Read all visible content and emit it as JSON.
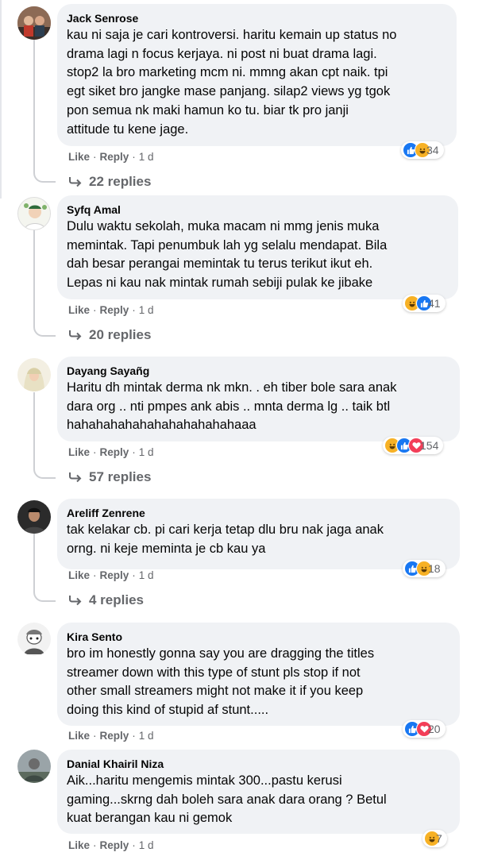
{
  "comments": [
    {
      "author": "Jack Senrose",
      "text": "kau ni saja je cari kontroversi. haritu kemain up status no\ndrama lagi n focus kerjaya. ni post ni buat drama lagi.\nstop2 la bro marketing mcm ni. mmng akan cpt naik. tpi\negt siket bro jangke mase panjang. silap2 views yg tgok\npon semua nk maki hamun ko tu. biar tk pro janji\nattitude tu kene jage.",
      "like": "Like",
      "reply": "Reply",
      "time": "1 d",
      "reactions": [
        "like",
        "haha"
      ],
      "count": "34",
      "replies": "22 replies"
    },
    {
      "author": "Syfq Amal",
      "text": "Dulu waktu sekolah, muka macam ni mmg jenis muka\nmemintak. Tapi penumbuk lah yg selalu mendapat. Bila\ndah besar perangai memintak tu terus terikut ikut eh.\nLepas ni kau nak mintak rumah sebiji pulak ke jibake",
      "like": "Like",
      "reply": "Reply",
      "time": "1 d",
      "reactions": [
        "haha",
        "like"
      ],
      "count": "41",
      "replies": "20 replies"
    },
    {
      "author": "Dayang Sayañg",
      "text": "Haritu dh mintak derma nk mkn. . eh tiber bole sara anak\ndara org .. nti pmpes ank abis .. mnta derma lg .. taik btl\nhahahahahahahahahahahahaaa",
      "like": "Like",
      "reply": "Reply",
      "time": "1 d",
      "reactions": [
        "haha",
        "like",
        "love"
      ],
      "count": "154",
      "replies": "57 replies"
    },
    {
      "author": "Areliff Zenrene",
      "text": "tak kelakar cb. pi cari kerja tetap dlu bru nak jaga anak\norng. ni keje meminta je cb kau ya",
      "like": "Like",
      "reply": "Reply",
      "time": "1 d",
      "reactions": [
        "like",
        "haha"
      ],
      "count": "18",
      "replies": "4 replies"
    },
    {
      "author": "Kira Sento",
      "text": "bro im honestly gonna say you are dragging the titles\nstreamer down with this type of stunt pls stop if not\nother small streamers might not make it if you keep\ndoing this kind of stupid af stunt.....",
      "like": "Like",
      "reply": "Reply",
      "time": "1 d",
      "reactions": [
        "like",
        "love"
      ],
      "count": "20",
      "replies": ""
    },
    {
      "author": "Danial Khairil Niza",
      "text": "Aik...haritu mengemis mintak 300...pastu kerusi\ngaming...skrng dah boleh sara anak dara orang ? Betul\nkuat berangan kau ni gemok",
      "like": "Like",
      "reply": "Reply",
      "time": "1 d",
      "reactions": [
        "haha"
      ],
      "count": "7",
      "replies": ""
    }
  ],
  "colors": {
    "bubble": "#f0f2f5",
    "meta": "#65676b",
    "like": "#1877f2",
    "haha": "#f7b125",
    "love": "#f33e58"
  }
}
